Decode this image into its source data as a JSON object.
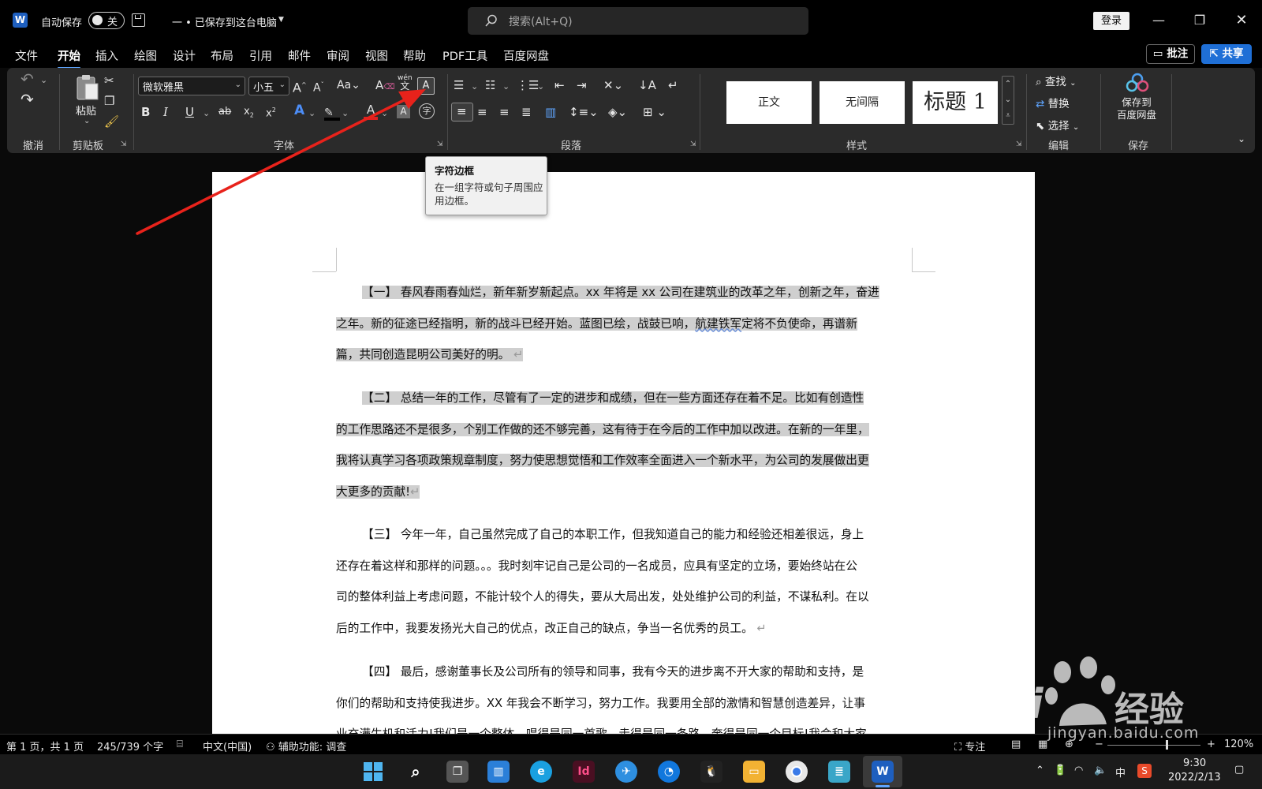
{
  "window": {
    "autosave_label": "自动保存",
    "autosave_state": "关",
    "doc_status": "一 • 已保存到这台电脑",
    "search_placeholder": "搜索(Alt+Q)",
    "login_label": "登录",
    "comment_label": "批注",
    "share_label": "共享"
  },
  "menu": {
    "tabs": [
      "文件",
      "开始",
      "插入",
      "绘图",
      "设计",
      "布局",
      "引用",
      "邮件",
      "审阅",
      "视图",
      "帮助",
      "PDF工具",
      "百度网盘"
    ],
    "active": "开始"
  },
  "ribbon": {
    "font_name": "微软雅黑",
    "font_size": "小五",
    "paste_label": "粘贴",
    "find_label": "查找",
    "replace_label": "替换",
    "select_label": "选择",
    "baidu_save_line1": "保存到",
    "baidu_save_line2": "百度网盘",
    "styles": [
      "正文",
      "无间隔",
      "标题 1"
    ],
    "groups": {
      "undo": "撤消",
      "clipboard": "剪贴板",
      "font": "字体",
      "paragraph": "段落",
      "styles": "样式",
      "editing": "编辑",
      "save": "保存"
    }
  },
  "tooltip": {
    "title": "字符边框",
    "description": "在一组字符或句子周围应用边框。"
  },
  "document": {
    "p1": [
      "【一】 春风春雨春灿烂，新年新岁新起点。xx 年将是 xx 公司在建筑业的改革之年，创新之年，奋进",
      "之年。新的征途已经指明，新的战斗已经开始。蓝图已绘，战鼓已响，",
      "航建铁军",
      "定将不负使命，再谱新",
      "篇，共同创造昆明公司美好的明。"
    ],
    "p2": [
      "【二】 总结一年的工作，尽管有了一定的进步和成绩，但在一些方面还存在着不足。比如有创造性",
      "的工作思路还不是很多，个别工作做的还不够完善，这有待于在今后的工作中加以改进。在新的一年里，",
      "我将认真学习各项政策规章制度，努力使思想觉悟和工作效率全面进入一个新水平，为公司的发展做出更",
      "大更多的贡献!"
    ],
    "p3": [
      "【三】 今年一年，自己虽然完成了自己的本职工作，但我知道自己的能力和经验还相差很远，身上",
      "还存在着这样和那样的问题。。。我时刻牢记自己是公司的一名成员，应具有坚定的立场，要始终站在公",
      "司的整体利益上考虑问题，不能计较个人的得失，要从大局出发，处处维护公司的利益，不谋私利。在以",
      "后的工作中，我要发扬光大自己的优点，改正自己的缺点，争当一名优秀的员工。"
    ],
    "p4": [
      "【四】 最后，感谢董事长及公司所有的领导和同事，我有今天的进步离不开大家的帮助和支持，是",
      "你们的帮助和支持使我进步。XX 年我会不断学习，努力工作。我要用全部的激情和智慧创造差异，让事",
      "业充满生机和活力!我们是一个整体，唱得是同一首歌，走得是同一条路，奔得是同一个目标!我会和大家"
    ]
  },
  "status": {
    "page": "第 1 页，共 1 页",
    "words": "245/739 个字",
    "language": "中文(中国)",
    "accessibility": "辅助功能: 调查",
    "focus": "专注",
    "zoom": "120%"
  },
  "taskbar": {
    "ime": "中",
    "time": "9:30",
    "date": "2022/2/13"
  },
  "watermark": {
    "brand": "Bai",
    "brand_suffix": "经验",
    "url": "jingyan.baidu.com"
  },
  "colors": {
    "accent": "#5fa5ff",
    "share": "#1f6fd6",
    "arrow": "#e8221b",
    "selection": "#cfcfcf"
  }
}
